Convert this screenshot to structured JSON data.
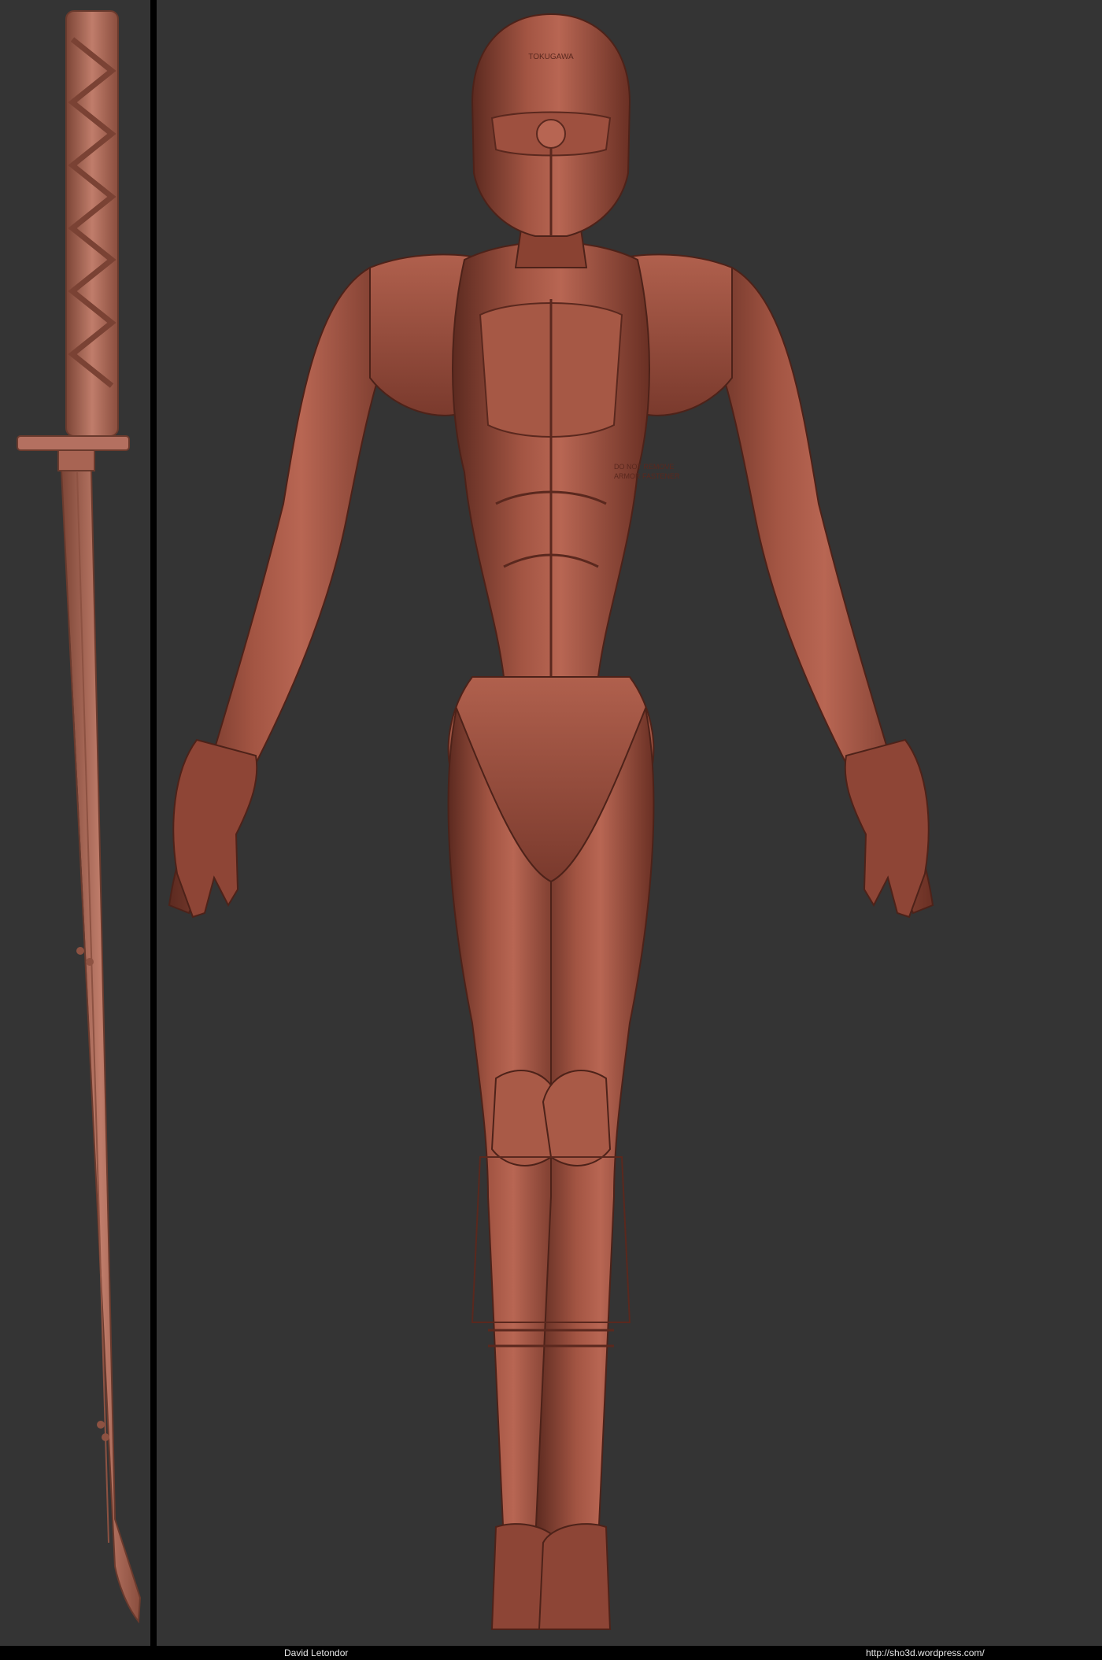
{
  "colors": {
    "background": "#343434",
    "divider": "#000000",
    "footer_background": "#000000",
    "footer_text": "#e8e8e8",
    "clay_base": "#93493a",
    "clay_light": "#b86653",
    "clay_dark": "#5c2a20",
    "sword_base": "#b57160",
    "sword_dark": "#7c4536"
  },
  "footer": {
    "credit_left": "David Letondor",
    "credit_right": "http://sho3d.wordpress.com/"
  },
  "sculpt": {
    "helmet_text": "TOKUGAWA",
    "chest_text_line1": "DO NOT REMOVE",
    "chest_text_line2": "ARMOR FASTENER"
  }
}
